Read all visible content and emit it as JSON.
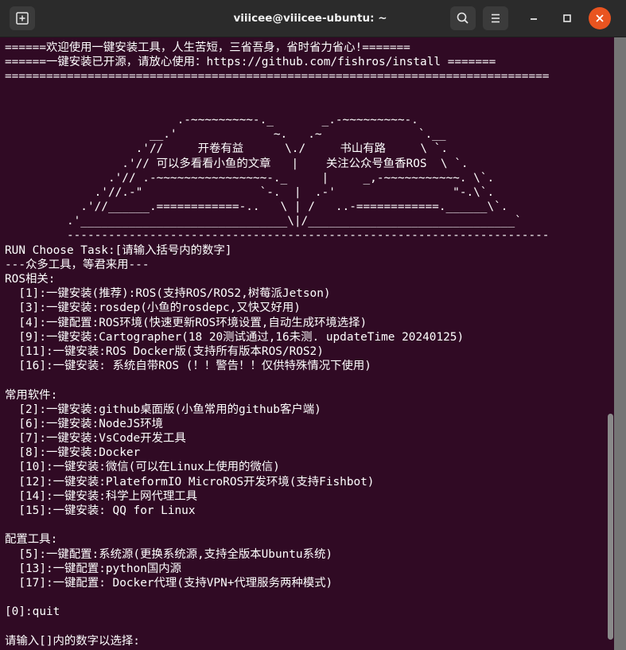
{
  "window": {
    "title": "viiicee@viiicee-ubuntu: ~"
  },
  "terminal": {
    "lines": [
      "======欢迎使用一键安装工具，人生苦短，三省吾身，省时省力省心!=======",
      "======一键安装已开源，请放心使用：https://github.com/fishros/install =======",
      "===============================================================================",
      "",
      "",
      "                         .-~~~~~~~~~-._       _.-~~~~~~~~~-.",
      "                     __.'              ~.   .~              `.__",
      "                   .'//     开卷有益      \\./     书山有路     \\ `.",
      "                 .'// 可以多看看小鱼的文章   |    关注公众号鱼香ROS  \\ `.",
      "               .'// .-~~~~~~~~~~~~~~~~-._     |     _,-~~~~~~~~~~~. \\`.",
      "             .'//.-\"                 `-.  |  .-'                 \"-.\\`.",
      "           .'//______.============-..   \\ | /   ..-============.______\\`.",
      "         .'______________________________\\|/______________________________`",
      "         ----------------------------------------------------------------------",
      "RUN Choose Task:[请输入括号内的数字]",
      "---众多工具，等君来用---",
      "ROS相关:",
      "  [1]:一键安装(推荐):ROS(支持ROS/ROS2,树莓派Jetson)",
      "  [3]:一键安装:rosdep(小鱼的rosdepc,又快又好用)",
      "  [4]:一键配置:ROS环境(快速更新ROS环境设置,自动生成环境选择)",
      "  [9]:一键安装:Cartographer(18 20测试通过,16未测. updateTime 20240125)",
      "  [11]:一键安装:ROS Docker版(支持所有版本ROS/ROS2)",
      "  [16]:一键安装: 系统自带ROS (！！警告！！仅供特殊情况下使用)",
      "",
      "常用软件:",
      "  [2]:一键安装:github桌面版(小鱼常用的github客户端)",
      "  [6]:一键安装:NodeJS环境",
      "  [7]:一键安装:VsCode开发工具",
      "  [8]:一键安装:Docker",
      "  [10]:一键安装:微信(可以在Linux上使用的微信)",
      "  [12]:一键安装:PlateformIO MicroROS开发环境(支持Fishbot)",
      "  [14]:一键安装:科学上网代理工具",
      "  [15]:一键安装: QQ for Linux",
      "",
      "配置工具:",
      "  [5]:一键配置:系统源(更换系统源,支持全版本Ubuntu系统)",
      "  [13]:一键配置:python国内源",
      "  [17]:一键配置: Docker代理(支持VPN+代理服务两种模式)",
      "",
      "[0]:quit",
      "",
      "请输入[]内的数字以选择:"
    ]
  },
  "colors": {
    "terminal_bg": "#300a24",
    "titlebar_bg": "#2b2b2b",
    "close_button": "#e95420",
    "text": "#ffffff"
  },
  "icons": {
    "new_tab": "new-tab-icon",
    "search": "search-icon",
    "menu": "hamburger-menu-icon",
    "minimize": "minimize-icon",
    "maximize": "maximize-icon",
    "close": "close-icon"
  }
}
